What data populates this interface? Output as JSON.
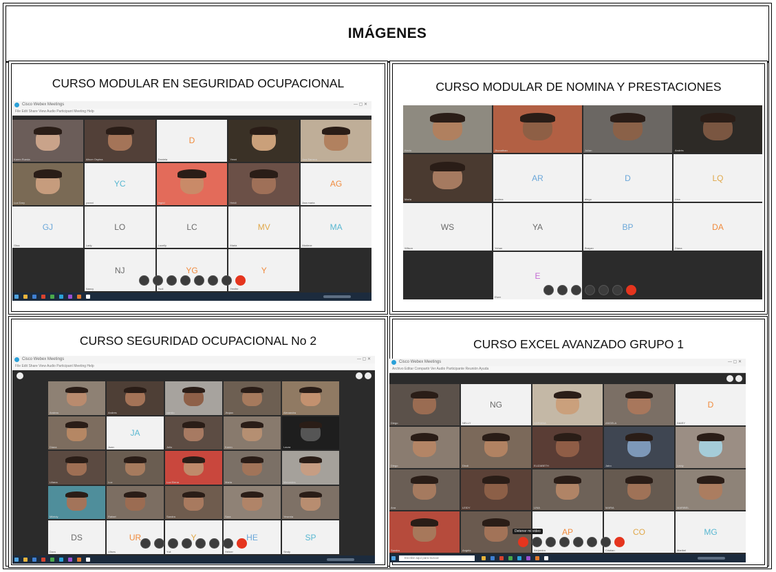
{
  "header": {
    "title": "IMÁGENES"
  },
  "colors": {
    "initial_text": [
      "#58b7d1",
      "#f08a3c",
      "#6aa7d9",
      "#e0a84a",
      "#c46bd4",
      "#6a6a6a"
    ],
    "red": "#e5351e",
    "taskbar": "#1c2b3d"
  },
  "panels": [
    {
      "caption": "CURSO MODULAR EN SEGURIDAD OCUPACIONAL",
      "window_title": "Cisco Webex Meetings",
      "menu": "File  Edit  Share  View  Audio  Participant  Meeting  Help",
      "cols": 5,
      "tiles": [
        {
          "t": "cam",
          "skin": "#c9a38a",
          "bg": "#6b5d59",
          "name": "Karen Rueda"
        },
        {
          "t": "cam",
          "skin": "#a47458",
          "bg": "#524038",
          "name": "Alison Ospina"
        },
        {
          "t": "init",
          "ini": "D",
          "c": 1,
          "name": "Daniela"
        },
        {
          "t": "cam",
          "skin": "#caa07a",
          "bg": "#3a3126",
          "name": "Yenni"
        },
        {
          "t": "cam",
          "skin": "#b1815f",
          "bg": "#bfae98",
          "name": "Ana Barrera"
        },
        {
          "t": "cam",
          "skin": "#c69c7d",
          "bg": "#7a6a55",
          "name": "Luz Dary"
        },
        {
          "t": "init",
          "ini": "YC",
          "c": 0,
          "name": "yurani"
        },
        {
          "t": "cam",
          "skin": "#c98a68",
          "bg": "#e36b5a",
          "name": "Ingrid"
        },
        {
          "t": "cam",
          "skin": "#9f7058",
          "bg": "#6b5047",
          "name": "Heidi"
        },
        {
          "t": "init",
          "ini": "AG",
          "c": 1,
          "name": "Ana maria"
        },
        {
          "t": "init",
          "ini": "GJ",
          "c": 2,
          "name": "Gina"
        },
        {
          "t": "init",
          "ini": "LO",
          "c": 5,
          "name": "Lady"
        },
        {
          "t": "init",
          "ini": "LC",
          "c": 5,
          "name": "Lucelly"
        },
        {
          "t": "init",
          "ini": "MV",
          "c": 3,
          "name": "Maria"
        },
        {
          "t": "init",
          "ini": "MA",
          "c": 0,
          "name": "Marlene"
        },
        {
          "t": "empty"
        },
        {
          "t": "init",
          "ini": "NJ",
          "c": 5,
          "name": "Nancy"
        },
        {
          "t": "init",
          "ini": "YG",
          "c": 1,
          "name": "Yudi"
        },
        {
          "t": "init",
          "ini": "Y",
          "c": 1,
          "name": "Yenifer"
        },
        {
          "t": "empty"
        }
      ]
    },
    {
      "caption": "CURSO MODULAR DE NOMINA Y PRESTACIONES",
      "cols": 4,
      "tiles": [
        {
          "t": "cam",
          "skin": "#b0805f",
          "bg": "#8e8a80",
          "name": "Kevin"
        },
        {
          "t": "cam",
          "skin": "#8e5f45",
          "bg": "#b26044",
          "name": "Jhonathan"
        },
        {
          "t": "cam",
          "skin": "#8a6148",
          "bg": "#6b6763",
          "name": "Julian"
        },
        {
          "t": "cam",
          "skin": "#7a5641",
          "bg": "#2d2a26",
          "name": "Andrés"
        },
        {
          "t": "cam",
          "skin": "#a57a60",
          "bg": "#4a3a30",
          "name": "Maria"
        },
        {
          "t": "init",
          "ini": "AR",
          "c": 2,
          "name": "andrea"
        },
        {
          "t": "init",
          "ini": "D",
          "c": 2,
          "name": "diego"
        },
        {
          "t": "init",
          "ini": "LQ",
          "c": 3,
          "name": "Lina"
        },
        {
          "t": "init",
          "ini": "WS",
          "c": 5,
          "name": "Wilson"
        },
        {
          "t": "init",
          "ini": "YA",
          "c": 5,
          "name": "Yohan"
        },
        {
          "t": "init",
          "ini": "BP",
          "c": 2,
          "name": "Brayan"
        },
        {
          "t": "init",
          "ini": "DA",
          "c": 1,
          "name": "Diana"
        },
        {
          "t": "empty"
        },
        {
          "t": "init",
          "ini": "E",
          "c": 4,
          "name": "Eiver"
        },
        {
          "t": "empty"
        },
        {
          "t": "empty"
        }
      ]
    },
    {
      "caption": "CURSO SEGURIDAD OCUPACIONAL No 2",
      "window_title": "Cisco Webex Meetings",
      "menu": "File  Edit  Share  View  Audio  Participant  Meeting  Help",
      "cols": 5,
      "tiles": [
        {
          "t": "cam",
          "skin": "#b98b6e",
          "bg": "#8e8174",
          "name": "Andrea"
        },
        {
          "t": "cam",
          "skin": "#a47357",
          "bg": "#4e3f36",
          "name": "Andres"
        },
        {
          "t": "cam",
          "skin": "#8e6048",
          "bg": "#a7a39e",
          "name": "camilo"
        },
        {
          "t": "cam",
          "skin": "#a67a5d",
          "bg": "#6d5f52",
          "name": "Jhojan"
        },
        {
          "t": "cam",
          "skin": "#c3916f",
          "bg": "#907a63",
          "name": "Alexandra"
        },
        {
          "t": "cam",
          "skin": "#b58764",
          "bg": "#7d6d5f",
          "name": "Diana"
        },
        {
          "t": "init",
          "ini": "JA",
          "c": 0,
          "name": "Juan"
        },
        {
          "t": "cam",
          "skin": "#a77a62",
          "bg": "#5c4c43",
          "name": "Julio"
        },
        {
          "t": "cam",
          "skin": "#b58f72",
          "bg": "#887a6d",
          "name": "Karen"
        },
        {
          "t": "cam",
          "skin": "#555555",
          "bg": "#1e1e1e",
          "name": "Laura"
        },
        {
          "t": "cam",
          "skin": "#9e6f54",
          "bg": "#5b4a41",
          "name": "Liliana"
        },
        {
          "t": "cam",
          "skin": "#a67b5e",
          "bg": "#6a5d51",
          "name": "Luz"
        },
        {
          "t": "cam",
          "skin": "#bf8a6b",
          "bg": "#c9473d",
          "name": "Luz Elena"
        },
        {
          "t": "cam",
          "skin": "#a17459",
          "bg": "#7b7066",
          "name": "Maria"
        },
        {
          "t": "cam",
          "skin": "#c69d83",
          "bg": "#a5a19b",
          "name": "Mercedes"
        },
        {
          "t": "cam",
          "skin": "#a3745a",
          "bg": "#4f8e9b",
          "name": "Mileidy"
        },
        {
          "t": "cam",
          "skin": "#9b6c52",
          "bg": "#7c6e62",
          "name": "Rafael"
        },
        {
          "t": "cam",
          "skin": "#a87a5f",
          "bg": "#6f5c4e",
          "name": "Sandra"
        },
        {
          "t": "cam",
          "skin": "#b08468",
          "bg": "#8f8276",
          "name": "Sara"
        },
        {
          "t": "cam",
          "skin": "#b88d70",
          "bg": "#7e7166",
          "name": "Yesenia"
        },
        {
          "t": "init",
          "ini": "DS",
          "c": 5,
          "name": "Dora"
        },
        {
          "t": "init",
          "ini": "UR",
          "c": 1,
          "name": "Ulises"
        },
        {
          "t": "init",
          "ini": "Y",
          "c": 3,
          "name": "Yuli"
        },
        {
          "t": "init",
          "ini": "HE",
          "c": 2,
          "name": "Heiner"
        },
        {
          "t": "init",
          "ini": "SP",
          "c": 0,
          "name": "Sindy"
        }
      ]
    },
    {
      "caption": "CURSO EXCEL AVANZADO GRUPO 1",
      "window_title": "Cisco Webex Meetings",
      "menu": "Archivo  Editar  Compartir  Ver  Audio  Participante  Reunión  Ayuda",
      "search_placeholder": "Escribe aquí para buscar",
      "tooltip": "Detener mi video",
      "cols": 5,
      "tiles": [
        {
          "t": "cam",
          "skin": "#9a6c52",
          "bg": "#5b514a",
          "name": "Diego"
        },
        {
          "t": "init",
          "ini": "NG",
          "c": 5,
          "name": "NELLY"
        },
        {
          "t": "cam",
          "skin": "#caa07c",
          "bg": "#c4b8a6",
          "name": "ADRIANA"
        },
        {
          "t": "cam",
          "skin": "#a8775c",
          "bg": "#7b6f65",
          "name": "ANGELA"
        },
        {
          "t": "init",
          "ini": "D",
          "c": 1,
          "name": "DAISY"
        },
        {
          "t": "cam",
          "skin": "#b38566",
          "bg": "#8a7c70",
          "name": "Diego"
        },
        {
          "t": "cam",
          "skin": "#b18262",
          "bg": "#7b695a",
          "name": "Dixdi"
        },
        {
          "t": "cam",
          "skin": "#8f5d46",
          "bg": "#5a3d35",
          "name": "ELIZABETH"
        },
        {
          "t": "cam",
          "skin": "#7d98b8",
          "bg": "#3f4652",
          "name": "Jairo"
        },
        {
          "t": "cam",
          "skin": "#a5ccd8",
          "bg": "#9b8e84",
          "name": "Leidy"
        },
        {
          "t": "cam",
          "skin": "#a57a5f",
          "bg": "#6a5e55",
          "name": "Ana"
        },
        {
          "t": "cam",
          "skin": "#8c5f47",
          "bg": "#5b4137",
          "name": "LEIDY"
        },
        {
          "t": "cam",
          "skin": "#b08466",
          "bg": "#6e6258",
          "name": "LINA"
        },
        {
          "t": "cam",
          "skin": "#9f7257",
          "bg": "#665a50",
          "name": "MARIA"
        },
        {
          "t": "cam",
          "skin": "#ab7d60",
          "bg": "#8e8378",
          "name": "MARIBEL"
        },
        {
          "t": "cam",
          "skin": "#a7785b",
          "bg": "#b64b3c",
          "name": "Sandra"
        },
        {
          "t": "cam",
          "skin": "#a27358",
          "bg": "#6a5a4f",
          "name": "Angela"
        },
        {
          "t": "init",
          "ini": "AP",
          "c": 1,
          "name": "Alejandra"
        },
        {
          "t": "init",
          "ini": "CO",
          "c": 3,
          "name": "Cristian"
        },
        {
          "t": "init",
          "ini": "MG",
          "c": 0,
          "name": "Maribel"
        }
      ]
    }
  ]
}
